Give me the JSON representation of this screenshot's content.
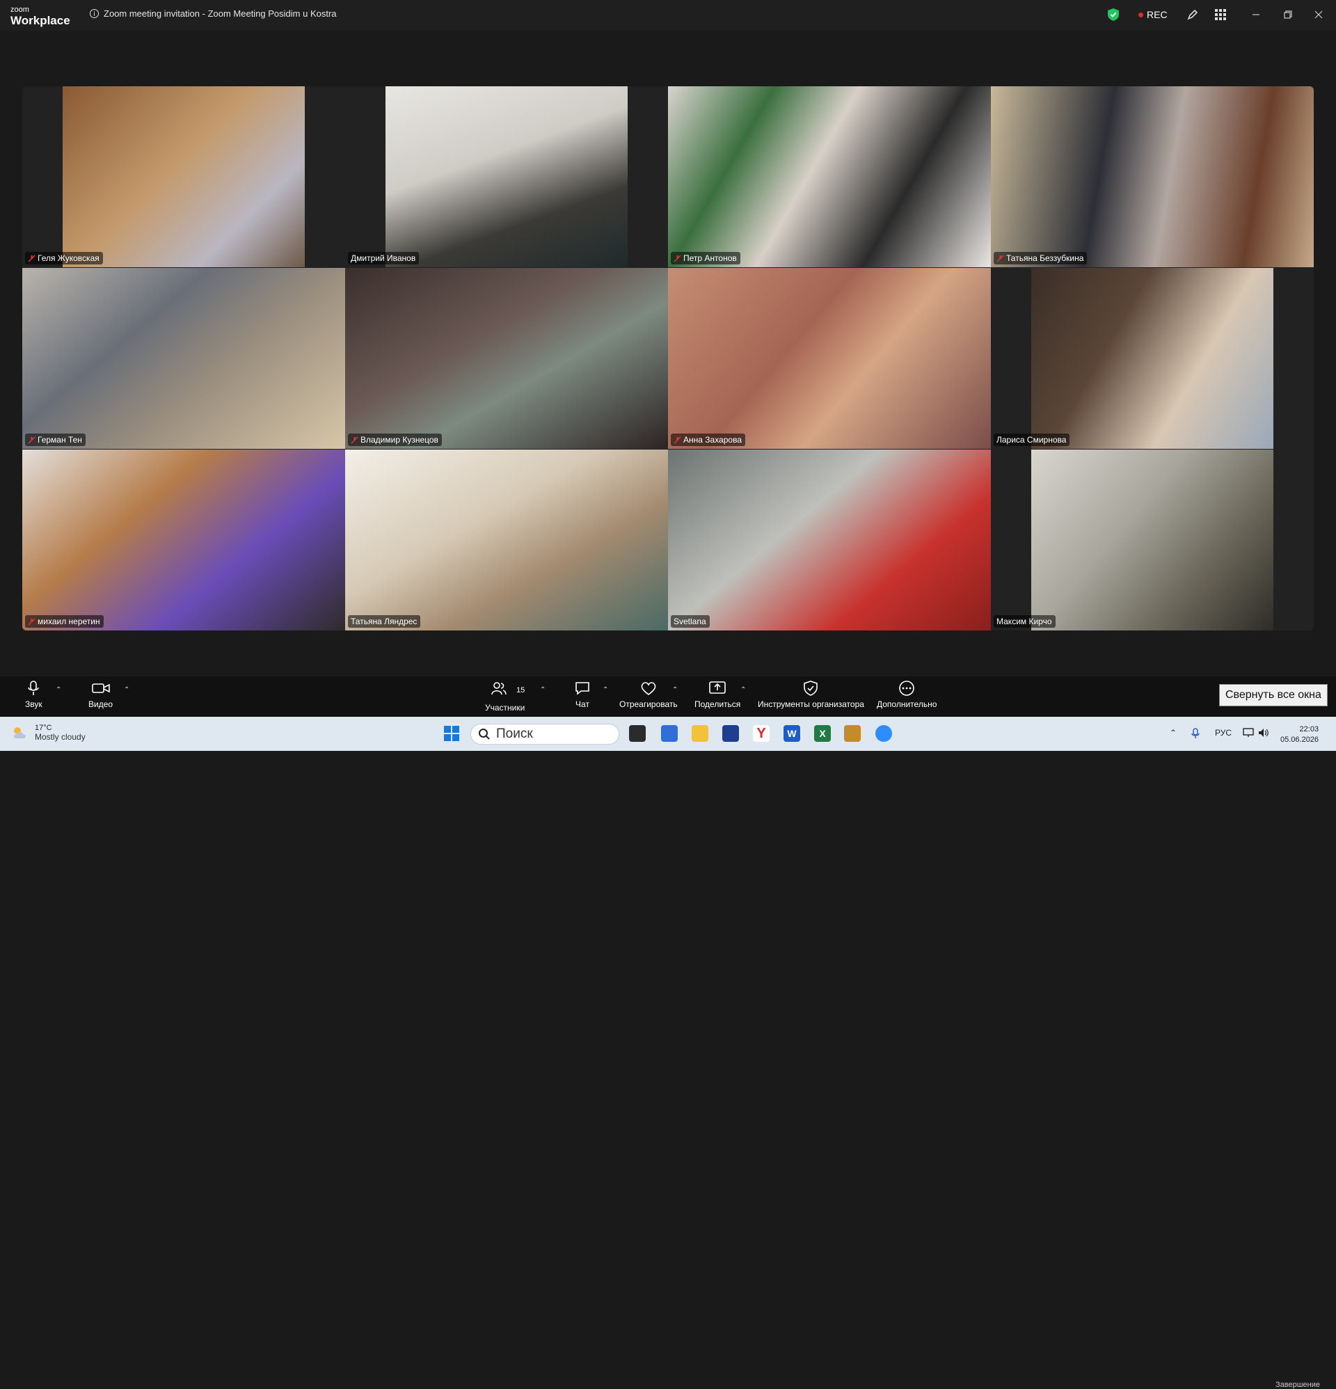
{
  "titlebar": {
    "logo_small": "zoom",
    "logo_big": "Workplace",
    "meeting_title": "Zoom meeting invitation - Zoom Meeting Posidim u Kostra",
    "rec_label": "REC"
  },
  "participants": [
    {
      "name": "Геля Жуковская",
      "muted": true
    },
    {
      "name": "Дмитрий Иванов",
      "muted": false
    },
    {
      "name": "Петр Антонов",
      "muted": true
    },
    {
      "name": "Татьяна Беззубкина",
      "muted": true
    },
    {
      "name": "Герман Тен",
      "muted": true
    },
    {
      "name": "Владимир Кузнецов",
      "muted": true
    },
    {
      "name": "Анна Захарова",
      "muted": true
    },
    {
      "name": "Лариса Смирнова",
      "muted": false
    },
    {
      "name": "михаил неретин",
      "muted": true
    },
    {
      "name": "Татьяна Ляндрес",
      "muted": false
    },
    {
      "name": "Svetlana",
      "muted": false
    },
    {
      "name": "Максим Кирчо",
      "muted": false
    }
  ],
  "toolbar": {
    "audio": "Звук",
    "video": "Видео",
    "participants": "Участники",
    "participants_count": "15",
    "chat": "Чат",
    "react": "Отреагировать",
    "share": "Поделиться",
    "host_tools": "Инструменты организатора",
    "more": "Дополнительно",
    "end_partial": "Завершение",
    "tooltip": "Свернуть все окна"
  },
  "taskbar": {
    "temperature": "17°C",
    "weather": "Mostly cloudy",
    "search_placeholder": "Поиск",
    "language": "РУС",
    "time": "22:03",
    "date": "05.06.2026"
  },
  "colors": {
    "active_speaker": "#2fce7a",
    "rec_dot": "#e0282d",
    "shield": "#22c55e"
  }
}
